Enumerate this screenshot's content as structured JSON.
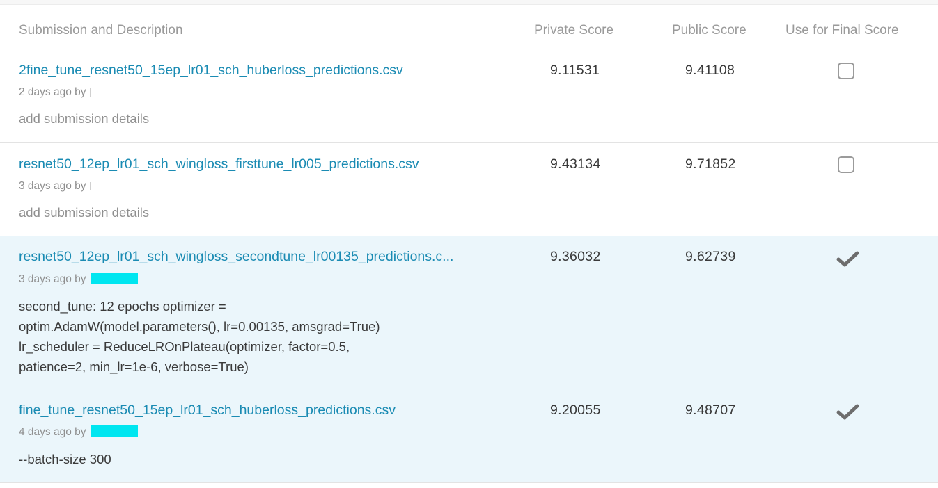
{
  "columns": {
    "submission": "Submission and Description",
    "private": "Private Score",
    "public": "Public Score",
    "final": "Use for Final Score"
  },
  "rows": [
    {
      "filename": "2fine_tune_resnet50_15ep_lr01_sch_huberloss_predictions.csv",
      "meta": "2 days ago by",
      "description": "add submission details",
      "private_score": "9.11531",
      "public_score": "9.41108",
      "final_selected": false
    },
    {
      "filename": "resnet50_12ep_lr01_sch_wingloss_firsttune_lr005_predictions.csv",
      "meta": "3 days ago by",
      "description": "add submission details",
      "private_score": "9.43134",
      "public_score": "9.71852",
      "final_selected": false
    },
    {
      "filename": "resnet50_12ep_lr01_sch_wingloss_secondtune_lr00135_predictions.c...",
      "meta": "3 days ago by",
      "description": "second_tune: 12 epochs optimizer = optim.AdamW(model.parameters(), lr=0.00135, amsgrad=True) lr_scheduler = ReduceLROnPlateau(optimizer, factor=0.5, patience=2, min_lr=1e-6, verbose=True)",
      "description_lines": [
        "second_tune: 12 epochs optimizer =",
        "optim.AdamW(model.parameters(), lr=0.00135, amsgrad=True)",
        "lr_scheduler = ReduceLROnPlateau(optimizer, factor=0.5,",
        "patience=2, min_lr=1e-6, verbose=True)"
      ],
      "private_score": "9.36032",
      "public_score": "9.62739",
      "final_selected": true
    },
    {
      "filename": "fine_tune_resnet50_15ep_lr01_sch_huberloss_predictions.csv",
      "meta": "4 days ago by",
      "description": "--batch-size 300",
      "private_score": "9.20055",
      "public_score": "9.48707",
      "final_selected": true
    }
  ],
  "colors": {
    "link": "#1a8bb3",
    "selected_row_bg": "#ebf6fb",
    "redaction": "#00e6f0",
    "checkmark": "#6d6d6d"
  },
  "icons": {
    "unchecked": "checkbox-empty-icon",
    "checked": "checkmark-icon"
  }
}
